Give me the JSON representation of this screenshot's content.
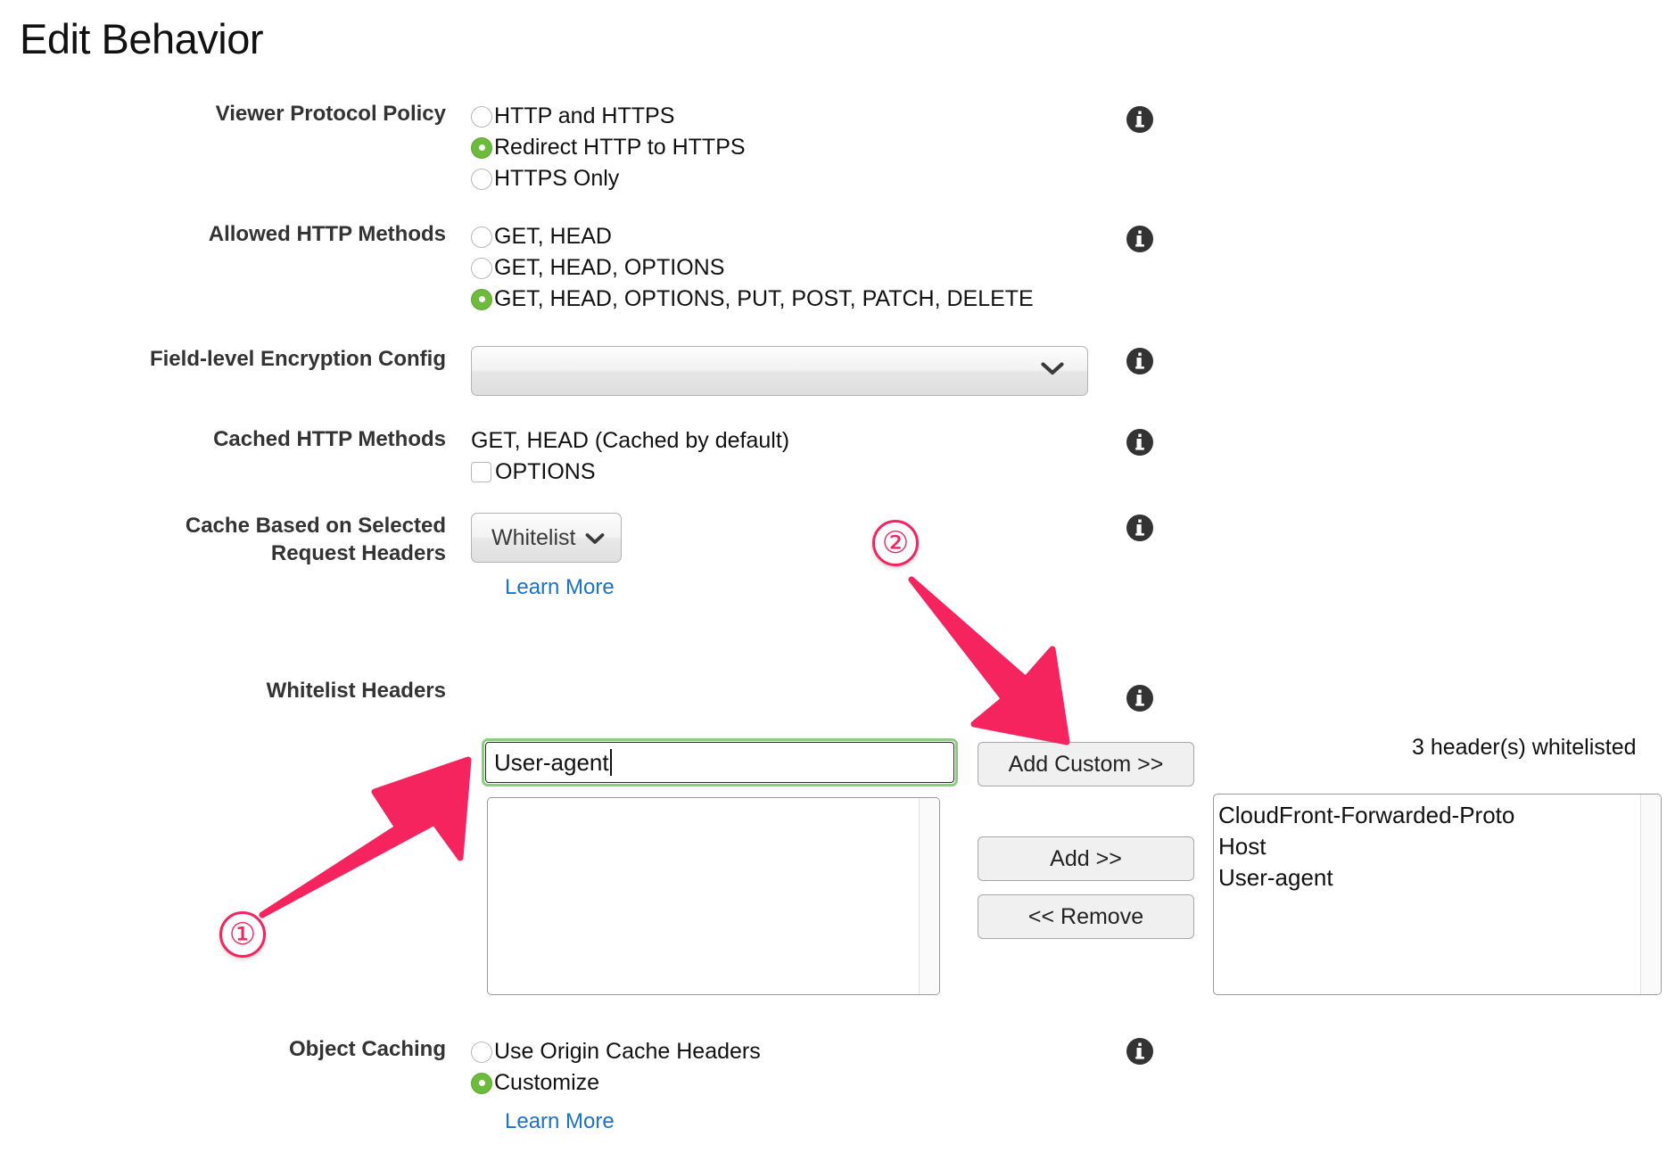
{
  "page": {
    "title": "Edit Behavior"
  },
  "fields": {
    "viewer_protocol_policy": {
      "label": "Viewer Protocol Policy",
      "options": [
        {
          "label": "HTTP and HTTPS",
          "selected": false
        },
        {
          "label": "Redirect HTTP to HTTPS",
          "selected": true
        },
        {
          "label": "HTTPS Only",
          "selected": false
        }
      ]
    },
    "allowed_http_methods": {
      "label": "Allowed HTTP Methods",
      "options": [
        {
          "label": "GET, HEAD",
          "selected": false
        },
        {
          "label": "GET, HEAD, OPTIONS",
          "selected": false
        },
        {
          "label": "GET, HEAD, OPTIONS, PUT, POST, PATCH, DELETE",
          "selected": true
        }
      ]
    },
    "field_level_encryption": {
      "label": "Field-level Encryption Config",
      "value": "",
      "chevron": "chevron-down-icon"
    },
    "cached_http_methods": {
      "label": "Cached HTTP Methods",
      "static_text": "GET, HEAD (Cached by default)",
      "checkbox_label": "OPTIONS",
      "checkbox_checked": false
    },
    "cache_based_on_headers": {
      "label": "Cache Based on Selected\nRequest Headers",
      "button_label": "Whitelist",
      "learn_more": "Learn More"
    },
    "whitelist_headers": {
      "label": "Whitelist Headers",
      "input_value": "User-agent",
      "available_items": [],
      "buttons": {
        "add_custom": "Add Custom >>",
        "add": "Add >>",
        "remove": "<< Remove"
      },
      "count_text": "3 header(s) whitelisted",
      "selected_items": [
        "CloudFront-Forwarded-Proto",
        "Host",
        "User-agent"
      ]
    },
    "object_caching": {
      "label": "Object Caching",
      "options": [
        {
          "label": "Use Origin Cache Headers",
          "selected": false
        },
        {
          "label": "Customize",
          "selected": true
        }
      ],
      "learn_more": "Learn More"
    }
  },
  "annotations": {
    "marker_one": "①",
    "marker_two": "②"
  },
  "colors": {
    "radio_selected": "#6cbb3c",
    "link": "#1a73c8",
    "annotation": "#f5245f",
    "focus_ring": "#8ccb82",
    "info_icon": "#333333"
  },
  "icons": {
    "info": "info-icon",
    "chevron_down": "chevron-down-icon"
  }
}
